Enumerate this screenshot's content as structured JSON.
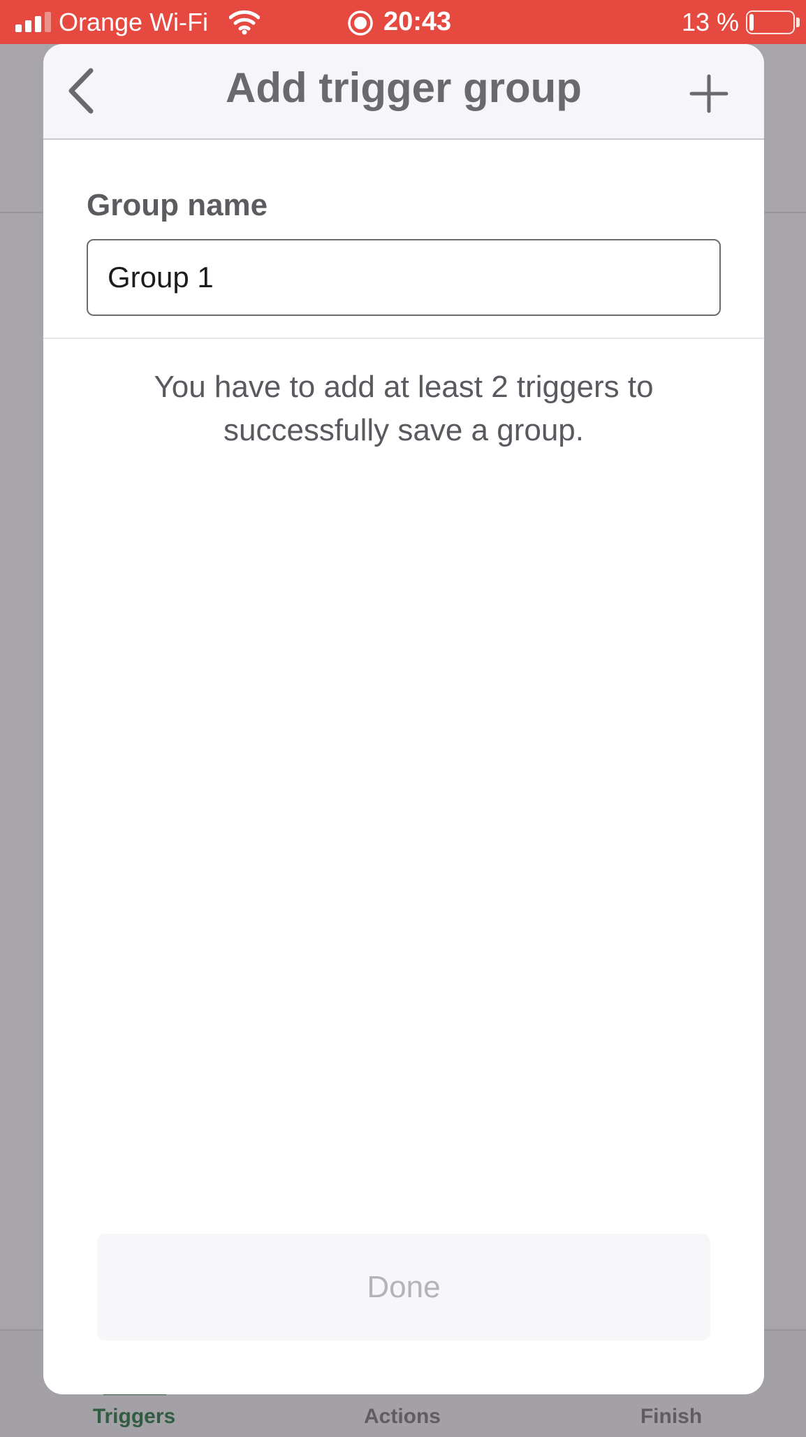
{
  "status_bar": {
    "carrier": "Orange Wi-Fi",
    "time": "20:43",
    "battery_percent": "13 %",
    "battery_level": 0.13,
    "icons": [
      "signal-icon",
      "wifi-icon",
      "screen-recording-icon",
      "battery-icon"
    ]
  },
  "background": {
    "tabs": [
      {
        "label": "Triggers",
        "active": true
      },
      {
        "label": "Actions",
        "active": false
      },
      {
        "label": "Finish",
        "active": false
      }
    ]
  },
  "modal": {
    "title": "Add trigger group",
    "back_icon": "chevron-left-icon",
    "add_icon": "plus-icon",
    "group_name_label": "Group name",
    "group_name_value": "Group 1",
    "info_text": "You have to add at least 2 triggers to successfully save a group.",
    "done_label": "Done",
    "done_enabled": false
  },
  "colors": {
    "status_bar": "#e5493f",
    "overlay": "#a8a5aa",
    "active_tab": "#325c42",
    "title_text": "#6b696e",
    "disabled_text": "#b4b3b8"
  }
}
